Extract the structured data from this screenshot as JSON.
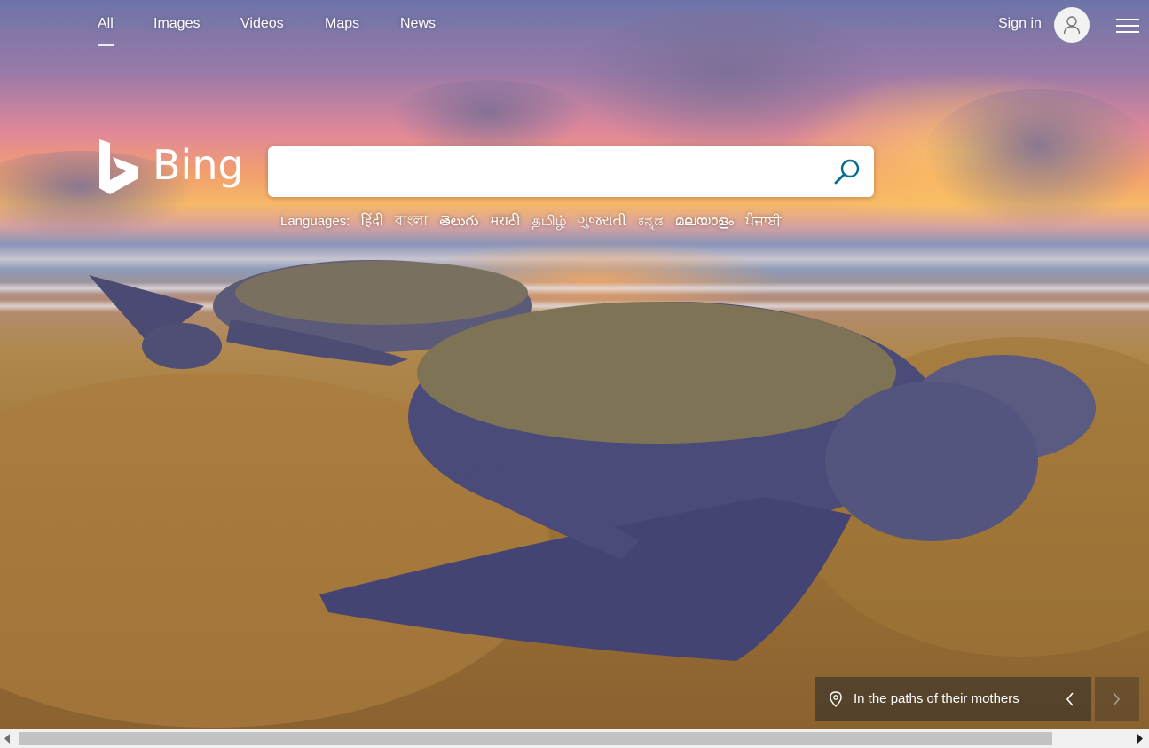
{
  "nav": {
    "tabs": [
      {
        "label": "All",
        "active": true
      },
      {
        "label": "Images",
        "active": false
      },
      {
        "label": "Videos",
        "active": false
      },
      {
        "label": "Maps",
        "active": false
      },
      {
        "label": "News",
        "active": false
      }
    ],
    "sign_in": "Sign in",
    "avatar_icon": "user-icon",
    "menu_icon": "hamburger-icon"
  },
  "logo": {
    "text": "Bing"
  },
  "search": {
    "value": "",
    "placeholder": "",
    "button_icon": "search-icon",
    "accent": "#006d8f"
  },
  "languages": {
    "label": "Languages:",
    "items": [
      "हिंदी",
      "বাংলা",
      "తెలుగు",
      "मराठी",
      "தமிழ்",
      "ગુજરાતી",
      "ಕನ್ನಡ",
      "മലയാളം",
      "ਪੰਜਾਬੀ"
    ]
  },
  "caption": {
    "text": "In the paths of their mothers",
    "pin_icon": "location-pin-icon",
    "prev_icon": "chevron-left-icon",
    "next_icon": "chevron-right-icon"
  }
}
